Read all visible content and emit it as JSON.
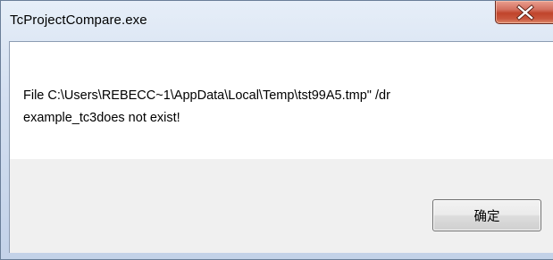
{
  "window": {
    "title": "TcProjectCompare.exe",
    "close_icon": "close-icon",
    "colors": {
      "frame": "#c3d2e8",
      "close_button": "#c0442c",
      "content_background": "#ffffff",
      "button_area": "#f0f0f0"
    }
  },
  "message": {
    "text": "File C:\\Users\\REBECC~1\\AppData\\Local\\Temp\\tst99A5.tmp\" /dr\nexample_tc3does not exist!"
  },
  "buttons": {
    "ok_label": "确定"
  }
}
